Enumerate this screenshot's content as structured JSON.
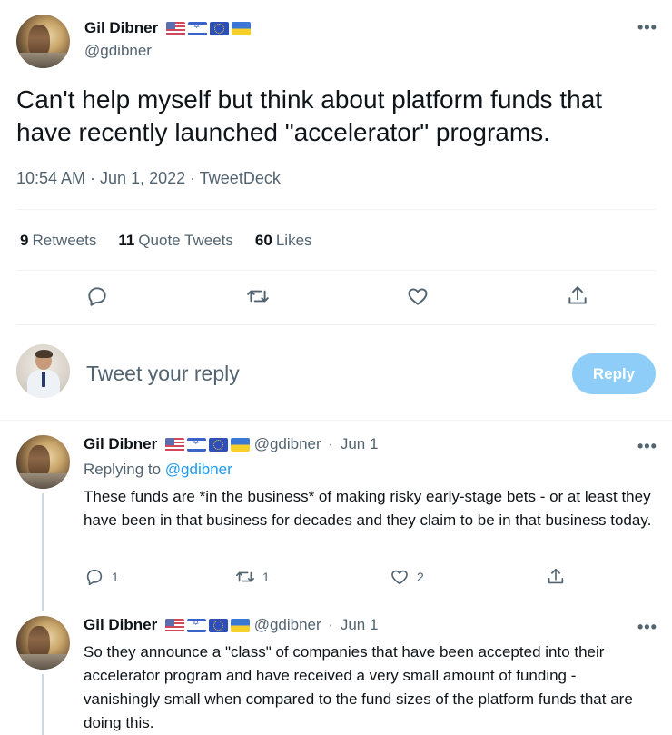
{
  "tweet": {
    "author_name": "Gil Dibner",
    "author_handle": "@gdibner",
    "flags": [
      "us-flag",
      "israel-flag",
      "eu-flag",
      "ukraine-flag"
    ],
    "text": "Can't help myself but think about platform funds that have recently launched \"accelerator\" programs.",
    "timestamp": "10:54 AM · Jun 1, 2022 · TweetDeck",
    "stats": {
      "retweets_count": "9",
      "retweets_label": "Retweets",
      "quotes_count": "11",
      "quotes_label": "Quote Tweets",
      "likes_count": "60",
      "likes_label": "Likes"
    },
    "more_label": "•••"
  },
  "compose": {
    "placeholder": "Tweet your reply",
    "button_label": "Reply"
  },
  "replies": [
    {
      "author_name": "Gil Dibner",
      "author_handle": "@gdibner",
      "date": "Jun 1",
      "replying_prefix": "Replying to",
      "replying_handle": "@gdibner",
      "text": "These funds are *in the business* of making risky early-stage bets - or at least they have been in that business for decades and they claim to be in that business today.",
      "reply_count": "1",
      "retweet_count": "1",
      "like_count": "2",
      "more_label": "•••"
    },
    {
      "author_name": "Gil Dibner",
      "author_handle": "@gdibner",
      "date": "Jun 1",
      "text": "So they announce a \"class\" of companies that have been accepted into their accelerator program and have received a very small amount of funding - vanishingly small when compared to the fund sizes of the platform funds that are doing this.",
      "more_label": "•••"
    }
  ],
  "icons": [
    "reply-icon",
    "retweet-icon",
    "like-icon",
    "share-icon"
  ]
}
